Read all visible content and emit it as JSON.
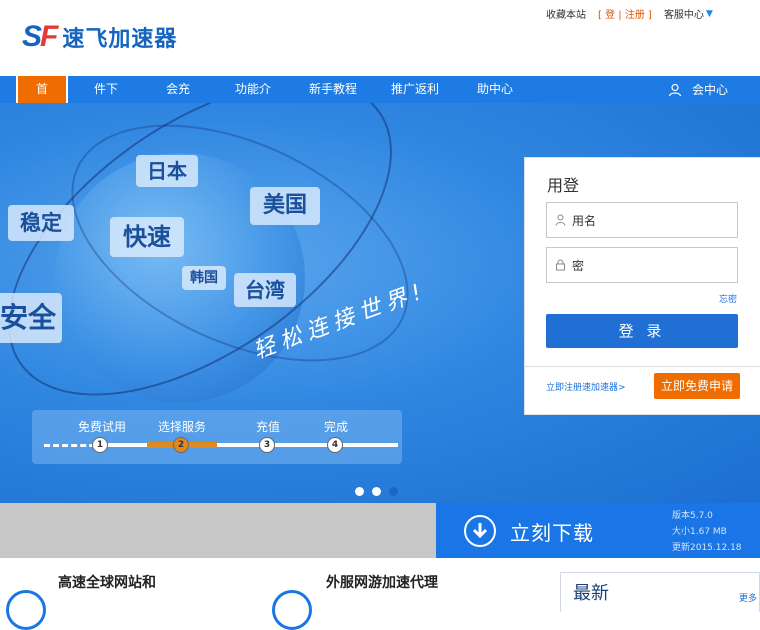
{
  "brand": {
    "mark_s": "S",
    "mark_f": "F",
    "name": "速飞加速器"
  },
  "toplinks": {
    "bookmark": "收藏本站",
    "login": "登",
    "register": "注册",
    "service": "客服中心"
  },
  "nav": {
    "items": [
      {
        "label": "首",
        "active": true
      },
      {
        "label": "件下"
      },
      {
        "label": "会充"
      },
      {
        "label": "功能介"
      },
      {
        "label": "新手教程"
      },
      {
        "label": "推广返利"
      },
      {
        "label": "助中心"
      }
    ],
    "user_center": "会中心"
  },
  "banner": {
    "tags": [
      "日本",
      "美国",
      "稳定",
      "快速",
      "韩国",
      "台湾",
      "安全"
    ],
    "slogan": "轻松连接世界!",
    "steps": [
      "免费试用",
      "选择服务",
      "充值",
      "完成"
    ],
    "step_numbers": [
      "1",
      "2",
      "3",
      "4"
    ],
    "active_step": 2
  },
  "login": {
    "title": "用登",
    "username_placeholder": "用名",
    "password_placeholder": "密",
    "forgot": "忘密",
    "submit": "登 录",
    "register_link": "立即注册速加速器>",
    "apply_button": "立即免费申请"
  },
  "download": {
    "label": "立刻下载",
    "version": "版本5.7.0",
    "size": "大小1.67 MB",
    "updated": "更新2015.12.18"
  },
  "features": [
    {
      "title": "高速全球网站和",
      "desc": ""
    },
    {
      "title": "外服网游加速代理",
      "desc": ""
    }
  ],
  "news": {
    "title": "最新",
    "more": "更多"
  },
  "colors": {
    "brand_blue": "#1e7be3",
    "accent_orange": "#ef6c00"
  }
}
